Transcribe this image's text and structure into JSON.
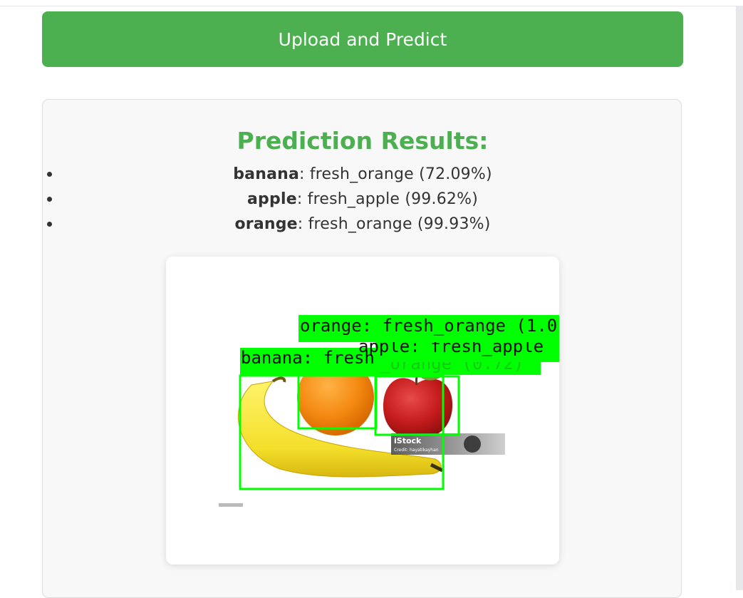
{
  "upload_button": {
    "label": "Upload and Predict"
  },
  "results": {
    "title": "Prediction Results:",
    "items": [
      {
        "fruit": "banana",
        "rest": ": fresh_orange (72.09%)"
      },
      {
        "fruit": "apple",
        "rest": ": fresh_apple (99.62%)"
      },
      {
        "fruit": "orange",
        "rest": ": fresh_orange (99.93%)"
      }
    ]
  },
  "annotated_image": {
    "labels": {
      "orange": "orange: fresh_orange (1.0",
      "apple": "apple: fresh_apple",
      "banana": "banana: fresh",
      "banana_hidden": "_orange (0.72)"
    },
    "watermark": {
      "brand": "iStock",
      "credit": "Credit: hayatikayhan"
    }
  },
  "colors": {
    "accent": "#4caf50",
    "box": "#00ff00"
  }
}
